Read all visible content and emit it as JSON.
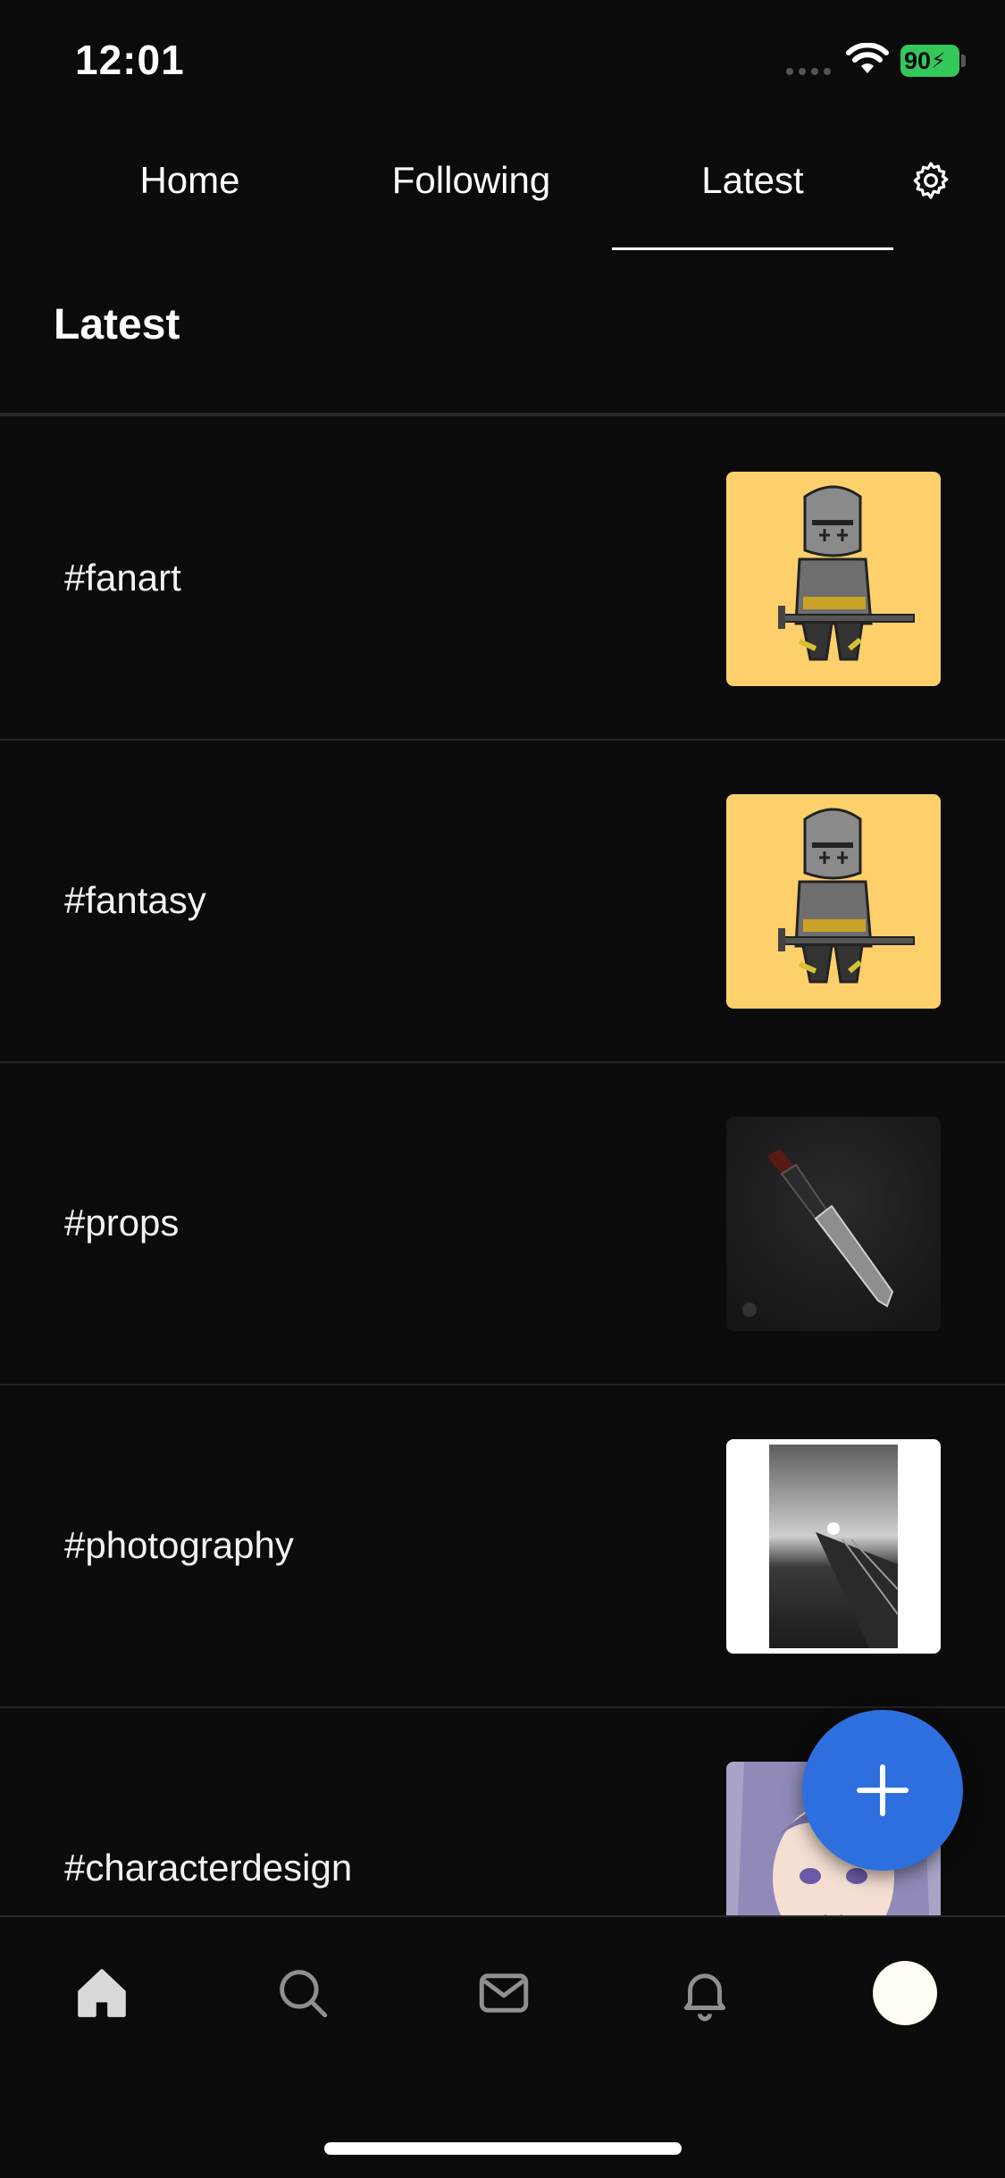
{
  "status_bar": {
    "time": "12:01",
    "battery": "90"
  },
  "tabs": [
    {
      "label": "Home"
    },
    {
      "label": "Following"
    },
    {
      "label": "Latest",
      "active": true
    }
  ],
  "page_title": "Latest",
  "tags": [
    {
      "label": "#fanart",
      "thumb": "knight-art"
    },
    {
      "label": "#fantasy",
      "thumb": "knight-art"
    },
    {
      "label": "#props",
      "thumb": "sword-art"
    },
    {
      "label": "#photography",
      "thumb": "pier-photo"
    },
    {
      "label": "#characterdesign",
      "thumb": "character-portrait"
    }
  ],
  "bottom_nav": [
    {
      "icon": "home-icon",
      "active": true
    },
    {
      "icon": "search-icon"
    },
    {
      "icon": "mail-icon"
    },
    {
      "icon": "bell-icon"
    },
    {
      "icon": "avatar"
    }
  ],
  "colors": {
    "background": "#0b0b0c",
    "accent": "#2d6fde",
    "battery": "#34c759",
    "thumb_yellow": "#fdd06c"
  }
}
